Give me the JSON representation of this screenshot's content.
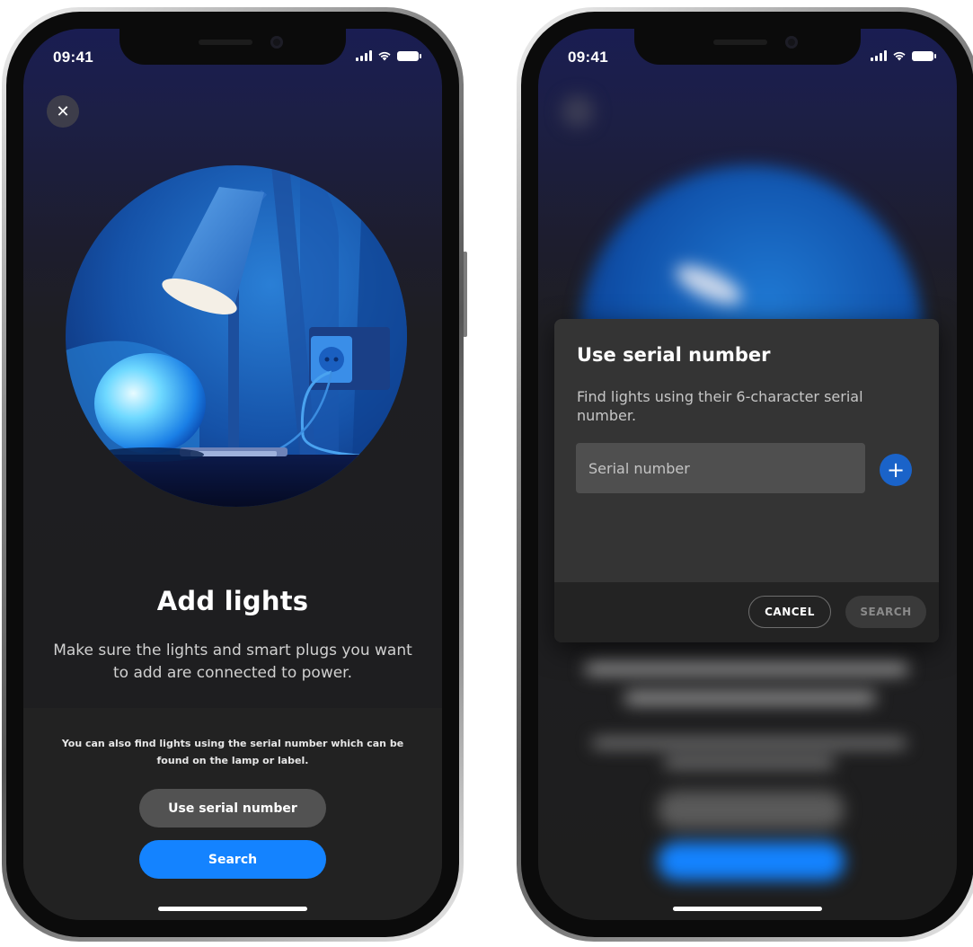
{
  "left_screen": {
    "status": {
      "time": "09:41"
    },
    "close_label": "✕",
    "title": "Add lights",
    "subtitle": "Make sure the lights and smart plugs you want to add are connected to power.",
    "hint": "You can also find lights using the serial number which can be found on the lamp or label.",
    "buttons": {
      "serial": "Use serial number",
      "search": "Search"
    }
  },
  "right_screen": {
    "status": {
      "time": "09:41"
    },
    "dialog": {
      "title": "Use serial number",
      "description": "Find lights using their 6-character serial number.",
      "input_placeholder": "Serial number",
      "add_label": "+",
      "cancel_label": "CANCEL",
      "search_label": "SEARCH"
    }
  },
  "icons": {
    "status": [
      "signal-icon",
      "wifi-icon",
      "battery-icon"
    ],
    "close": "close-icon",
    "add": "plus-icon"
  },
  "colors": {
    "accent_blue": "#1483ff",
    "dialog_bg": "#343434",
    "screen_bg": "#1e1e1e",
    "secondary_button": "#525252"
  }
}
